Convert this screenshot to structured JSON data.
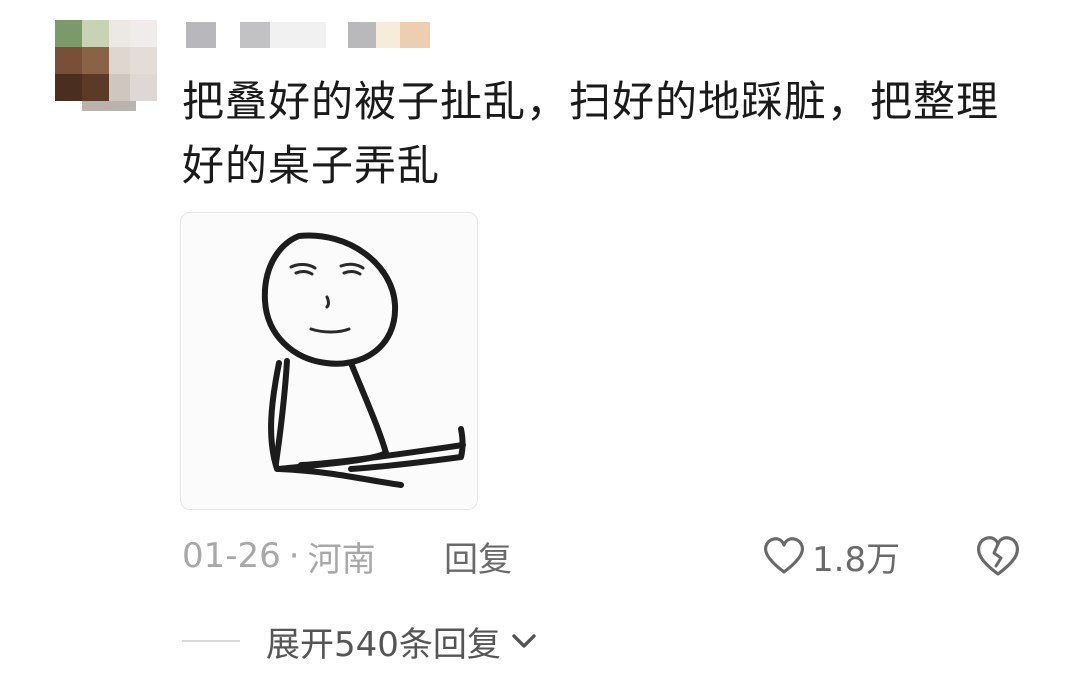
{
  "comment": {
    "text": "把叠好的被子扯乱，扫好的地踩脏，把整理好的桌子弄乱",
    "date": "01-26",
    "separator": "·",
    "location": "河南",
    "reply_label": "回复",
    "like_count": "1.8万",
    "expand_label": "展开540条回复"
  },
  "icons": {
    "like": "heart-outline-icon",
    "dislike": "broken-heart-icon",
    "expand": "chevron-down-icon"
  },
  "colors": {
    "text": "#1a1a1a",
    "meta": "#a8a8a8",
    "action": "#6a6a6a"
  }
}
